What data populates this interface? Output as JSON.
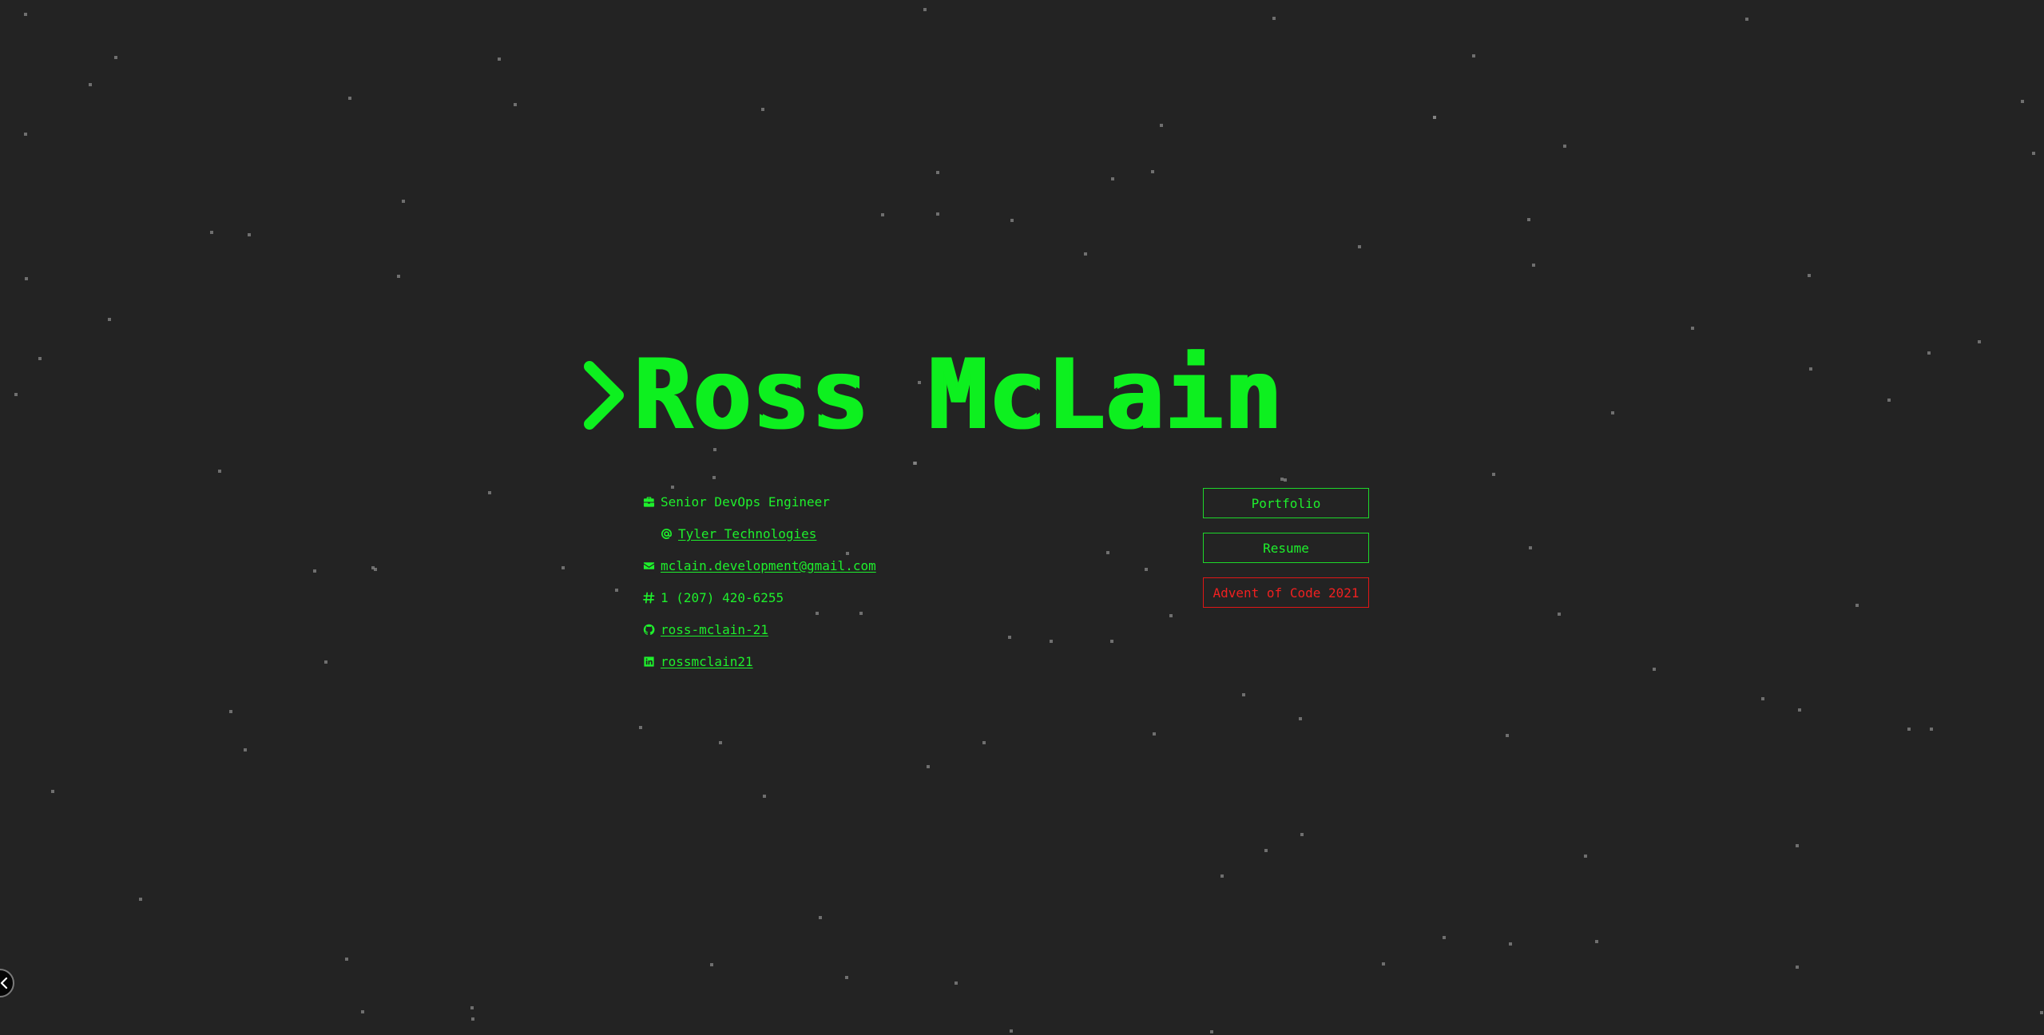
{
  "page": {
    "background_color": "#232323",
    "accent_color": "#0df01f",
    "alert_color": "#f02020",
    "star_color": "#8a8a8a"
  },
  "header": {
    "prompt_icon": "chevron-right-icon",
    "title": "Ross McLain"
  },
  "info": {
    "job_icon": "briefcase-icon",
    "job_title": "Senior DevOps Engineer",
    "company_icon": "at-icon",
    "company": "Tyler Technologies",
    "email_icon": "envelope-icon",
    "email": "mclain.development@gmail.com",
    "phone_icon": "hashtag-icon",
    "phone": "1 (207) 420-6255",
    "github_icon": "github-icon",
    "github": "ross-mclain-21",
    "linkedin_icon": "linkedin-icon",
    "linkedin": "rossmclain21"
  },
  "buttons": {
    "portfolio": "Portfolio",
    "resume": "Resume",
    "advent": "Advent of Code 2021"
  },
  "corner_toggle": {
    "icon": "chevron-left-icon"
  }
}
